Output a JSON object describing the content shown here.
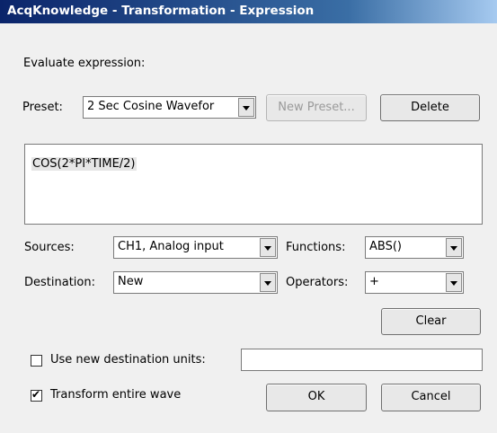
{
  "window": {
    "title": "AcqKnowledge - Transformation - Expression"
  },
  "evaluate_label": "Evaluate expression:",
  "preset": {
    "label": "Preset:",
    "value": "2 Sec Cosine Wavefor",
    "new_button": "New Preset...",
    "delete_button": "Delete"
  },
  "expression": "COS(2*PI*TIME/2)",
  "sources": {
    "label": "Sources:",
    "value": "CH1, Analog input"
  },
  "functions": {
    "label": "Functions:",
    "value": "ABS()"
  },
  "destination": {
    "label": "Destination:",
    "value": "New"
  },
  "operators": {
    "label": "Operators:",
    "value": "+"
  },
  "clear_button": "Clear",
  "use_units": {
    "label": "Use new destination units:",
    "checked": false,
    "value": ""
  },
  "transform_entire": {
    "label": "Transform entire wave",
    "checked": true
  },
  "ok_button": "OK",
  "cancel_button": "Cancel"
}
